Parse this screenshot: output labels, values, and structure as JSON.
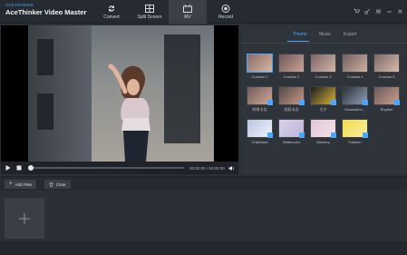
{
  "app": {
    "subtitle": "ACETHINKER",
    "title": "AceThinker Video Master"
  },
  "nav": [
    {
      "label": "Convert",
      "icon": "convert-icon"
    },
    {
      "label": "Split Screen",
      "icon": "split-screen-icon"
    },
    {
      "label": "MV",
      "icon": "mv-icon",
      "active": true
    },
    {
      "label": "Record",
      "icon": "record-icon"
    }
  ],
  "player": {
    "time": "00:00:00 / 00:00:00"
  },
  "panel": {
    "tabs": [
      "Theme",
      "Music",
      "Export"
    ],
    "active_tab": "Theme",
    "themes": [
      {
        "label": "Concise 1",
        "selected": true
      },
      {
        "label": "Concise 2"
      },
      {
        "label": "Concise 3"
      },
      {
        "label": "Concise 4"
      },
      {
        "label": "Concise 5"
      },
      {
        "label": "时尚卡点"
      },
      {
        "label": "炫彩卡点"
      },
      {
        "label": "七夕"
      },
      {
        "label": "Graduation..."
      },
      {
        "label": "Rhythm"
      },
      {
        "label": "Childhood"
      },
      {
        "label": "Watercolor"
      },
      {
        "label": "Memory"
      },
      {
        "label": "Fashion"
      }
    ]
  },
  "bottom": {
    "add_files": "Add Files",
    "clear": "Clear"
  },
  "colors": {
    "accent": "#4aa7ff",
    "bg": "#2b2f36"
  }
}
